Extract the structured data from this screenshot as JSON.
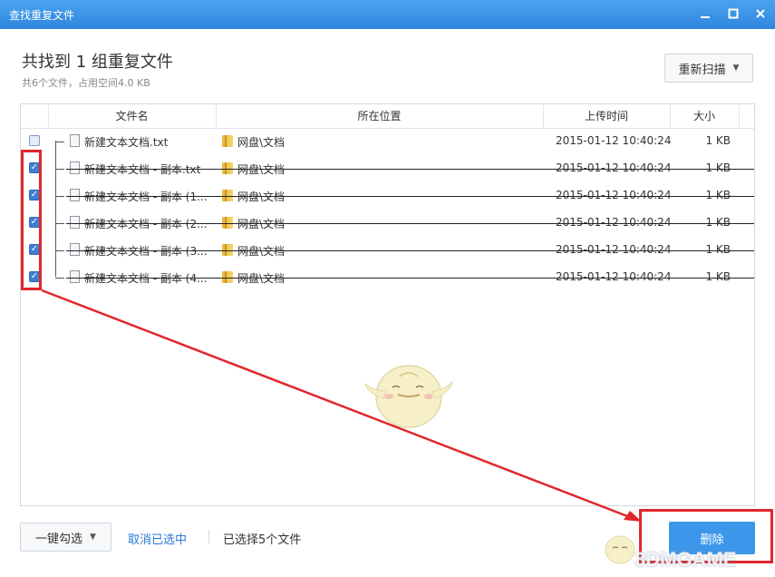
{
  "window": {
    "title": "查找重复文件",
    "controls": [
      "minimize-icon",
      "maximize-icon",
      "close-icon"
    ]
  },
  "summary": {
    "heading": "共找到 1 组重复文件",
    "subheading": "共6个文件，占用空间4.0 KB"
  },
  "toolbar": {
    "rescan_label": "重新扫描"
  },
  "table": {
    "columns": [
      "文件名",
      "所在位置",
      "上传时间",
      "大小"
    ],
    "rows": [
      {
        "checked": false,
        "name": "新建文本文档.txt",
        "location": "网盘\\文档",
        "time": "2015-01-12 10:40:24",
        "size": "1 KB",
        "struck": false
      },
      {
        "checked": true,
        "name": "新建文本文档 - 副本.txt",
        "location": "网盘\\文档",
        "time": "2015-01-12 10:40:24",
        "size": "1 KB",
        "struck": true
      },
      {
        "checked": true,
        "name": "新建文本文档 - 副本 (1...",
        "location": "网盘\\文档",
        "time": "2015-01-12 10:40:24",
        "size": "1 KB",
        "struck": true
      },
      {
        "checked": true,
        "name": "新建文本文档 - 副本 (2...",
        "location": "网盘\\文档",
        "time": "2015-01-12 10:40:24",
        "size": "1 KB",
        "struck": true
      },
      {
        "checked": true,
        "name": "新建文本文档 - 副本 (3...",
        "location": "网盘\\文档",
        "time": "2015-01-12 10:40:24",
        "size": "1 KB",
        "struck": true
      },
      {
        "checked": true,
        "name": "新建文本文档 - 副本 (4...",
        "location": "网盘\\文档",
        "time": "2015-01-12 10:40:24",
        "size": "1 KB",
        "struck": true
      }
    ]
  },
  "footer": {
    "select_one_key_label": "一键勾选",
    "cancel_selection_label": "取消已选中",
    "selected_count_text": "已选择5个文件",
    "delete_label": "删除"
  },
  "watermark": "3DMGAME",
  "colors": {
    "titlebar": "#2f86dd",
    "accent": "#3c97ea",
    "link": "#2b78d6",
    "annotation": "#e0262a"
  }
}
